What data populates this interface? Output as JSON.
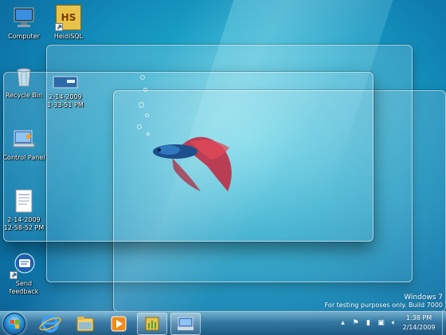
{
  "desktop": {
    "icons": [
      {
        "label": "Computer",
        "icon": "computer-icon"
      },
      {
        "label": "HeidiSQL",
        "icon": "heidisql-icon",
        "badge": "HS"
      },
      {
        "label": "Recycle Bin",
        "icon": "recycle-bin-icon"
      },
      {
        "label": "2-14-2009\n1-33-51 PM",
        "icon": "screenshot-file-icon"
      },
      {
        "label": "Control Panel",
        "icon": "control-panel-icon"
      },
      {
        "label": "2-14-2009\n12-58-52 PM",
        "icon": "document-file-icon"
      },
      {
        "label": "Send\nfeedback",
        "icon": "send-feedback-icon"
      }
    ]
  },
  "watermark": {
    "line1": "Windows 7",
    "line2": "For testing purposes only. Build 7000"
  },
  "taskbar": {
    "items": [
      {
        "name": "internet-explorer-icon",
        "state": "pinned"
      },
      {
        "name": "windows-explorer-icon",
        "state": "pinned"
      },
      {
        "name": "media-player-icon",
        "state": "pinned"
      },
      {
        "name": "heidisql-icon",
        "state": "running"
      },
      {
        "name": "control-panel-icon",
        "state": "running"
      }
    ],
    "tray_icons": [
      "chevron-up-icon",
      "action-center-flag-icon",
      "battery-icon",
      "network-icon",
      "volume-icon"
    ],
    "clock": {
      "time": "1:38 PM",
      "date": "2/14/2009"
    }
  },
  "colors": {
    "wallpaper": "#1aa3c8",
    "glass_border": "#ffffff",
    "taskbar": "#2f6f99"
  }
}
